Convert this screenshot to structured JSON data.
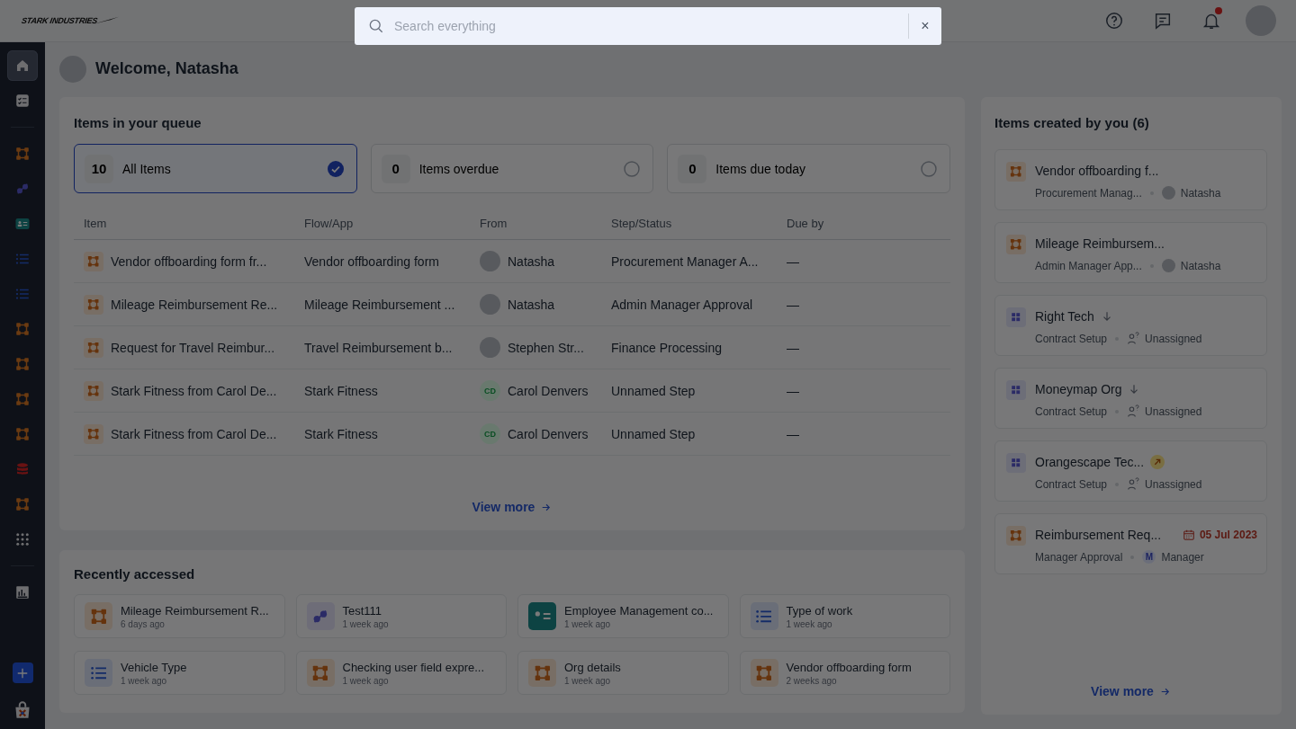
{
  "logo": {
    "text": "STARK INDUSTRIES"
  },
  "search": {
    "placeholder": "Search everything",
    "clear": "×"
  },
  "topbar": {
    "notification_dot": true
  },
  "sidebar": {
    "items": [
      {
        "kind": "home",
        "selected": true
      },
      {
        "kind": "tasks",
        "selected": false
      },
      {
        "kind": "divider"
      },
      {
        "kind": "flow",
        "selected": false
      },
      {
        "kind": "integration",
        "selected": false
      },
      {
        "kind": "app",
        "selected": false
      },
      {
        "kind": "list",
        "selected": false
      },
      {
        "kind": "list",
        "selected": false
      },
      {
        "kind": "flow",
        "selected": false
      },
      {
        "kind": "flow",
        "selected": false
      },
      {
        "kind": "flow",
        "selected": false
      },
      {
        "kind": "flow",
        "selected": false
      },
      {
        "kind": "database",
        "selected": false
      },
      {
        "kind": "flow",
        "selected": false
      },
      {
        "kind": "grid",
        "selected": false
      },
      {
        "kind": "divider"
      },
      {
        "kind": "chart",
        "selected": false
      }
    ],
    "bottom": [
      {
        "kind": "plus"
      },
      {
        "kind": "store"
      }
    ]
  },
  "welcome": "Welcome, Natasha",
  "queue": {
    "title": "Items in your queue",
    "filters": [
      {
        "count": "10",
        "label": "All Items",
        "selected": true
      },
      {
        "count": "0",
        "label": "Items overdue",
        "selected": false
      },
      {
        "count": "0",
        "label": "Items due today",
        "selected": false
      }
    ],
    "columns": [
      "Item",
      "Flow/App",
      "From",
      "Step/Status",
      "Due by"
    ],
    "rows": [
      {
        "item": "Vendor offboarding form fr...",
        "flow": "Vendor offboarding form",
        "from": {
          "kind": "photo",
          "name": "Natasha"
        },
        "step": "Procurement Manager A...",
        "due": "—"
      },
      {
        "item": "Mileage Reimbursement Re...",
        "flow": "Mileage Reimbursement ...",
        "from": {
          "kind": "photo",
          "name": "Natasha"
        },
        "step": "Admin Manager Approval",
        "due": "—"
      },
      {
        "item": "Request for Travel Reimbur...",
        "flow": "Travel Reimbursement b...",
        "from": {
          "kind": "photo",
          "name": "Stephen Str..."
        },
        "step": "Finance Processing",
        "due": "—"
      },
      {
        "item": "Stark Fitness from Carol De...",
        "flow": "Stark Fitness",
        "from": {
          "kind": "initials",
          "initials": "CD",
          "name": "Carol Denvers"
        },
        "step": "Unnamed Step",
        "due": "—"
      },
      {
        "item": "Stark Fitness from Carol De...",
        "flow": "Stark Fitness",
        "from": {
          "kind": "initials",
          "initials": "CD",
          "name": "Carol Denvers"
        },
        "step": "Unnamed Step",
        "due": "—"
      }
    ],
    "view_more": "View more"
  },
  "recent": {
    "title": "Recently accessed",
    "items": [
      {
        "kind": "flow",
        "name": "Mileage Reimbursement R...",
        "time": "6 days ago"
      },
      {
        "kind": "integration",
        "name": "Test111",
        "time": "1 week ago"
      },
      {
        "kind": "app",
        "name": "Employee Management co...",
        "time": "1 week ago"
      },
      {
        "kind": "list",
        "name": "Type of work",
        "time": "1 week ago"
      },
      {
        "kind": "list",
        "name": "Vehicle Type",
        "time": "1 week ago"
      },
      {
        "kind": "flow",
        "name": "Checking user field expre...",
        "time": "1 week ago"
      },
      {
        "kind": "flow",
        "name": "Org details",
        "time": "1 week ago"
      },
      {
        "kind": "flow",
        "name": "Vendor offboarding form",
        "time": "2 weeks ago"
      }
    ]
  },
  "created": {
    "title": "Items created by you (6)",
    "items": [
      {
        "kind": "flow",
        "title": "Vendor offboarding f...",
        "step": "Procurement Manag...",
        "assignee": {
          "kind": "photo",
          "name": "Natasha"
        }
      },
      {
        "kind": "flow",
        "title": "Mileage Reimbursem...",
        "step": "Admin Manager App...",
        "assignee": {
          "kind": "photo",
          "name": "Natasha"
        }
      },
      {
        "kind": "datalist",
        "title": "Right Tech",
        "marker": {
          "kind": "down"
        },
        "step": "Contract Setup",
        "assignee": {
          "kind": "unassigned",
          "name": "Unassigned"
        }
      },
      {
        "kind": "datalist",
        "title": "Moneymap Org",
        "marker": {
          "kind": "down"
        },
        "step": "Contract Setup",
        "assignee": {
          "kind": "unassigned",
          "name": "Unassigned"
        }
      },
      {
        "kind": "datalist",
        "title": "Orangescape Tec...",
        "marker": {
          "kind": "up-right"
        },
        "step": "Contract Setup",
        "assignee": {
          "kind": "unassigned",
          "name": "Unassigned"
        }
      },
      {
        "kind": "flow",
        "title": "Reimbursement Req...",
        "marker": {
          "kind": "date",
          "text": "05 Jul 2023"
        },
        "step": "Manager Approval",
        "assignee": {
          "kind": "initial",
          "initial": "M",
          "name": "Manager"
        }
      }
    ],
    "view_more": "View more"
  }
}
